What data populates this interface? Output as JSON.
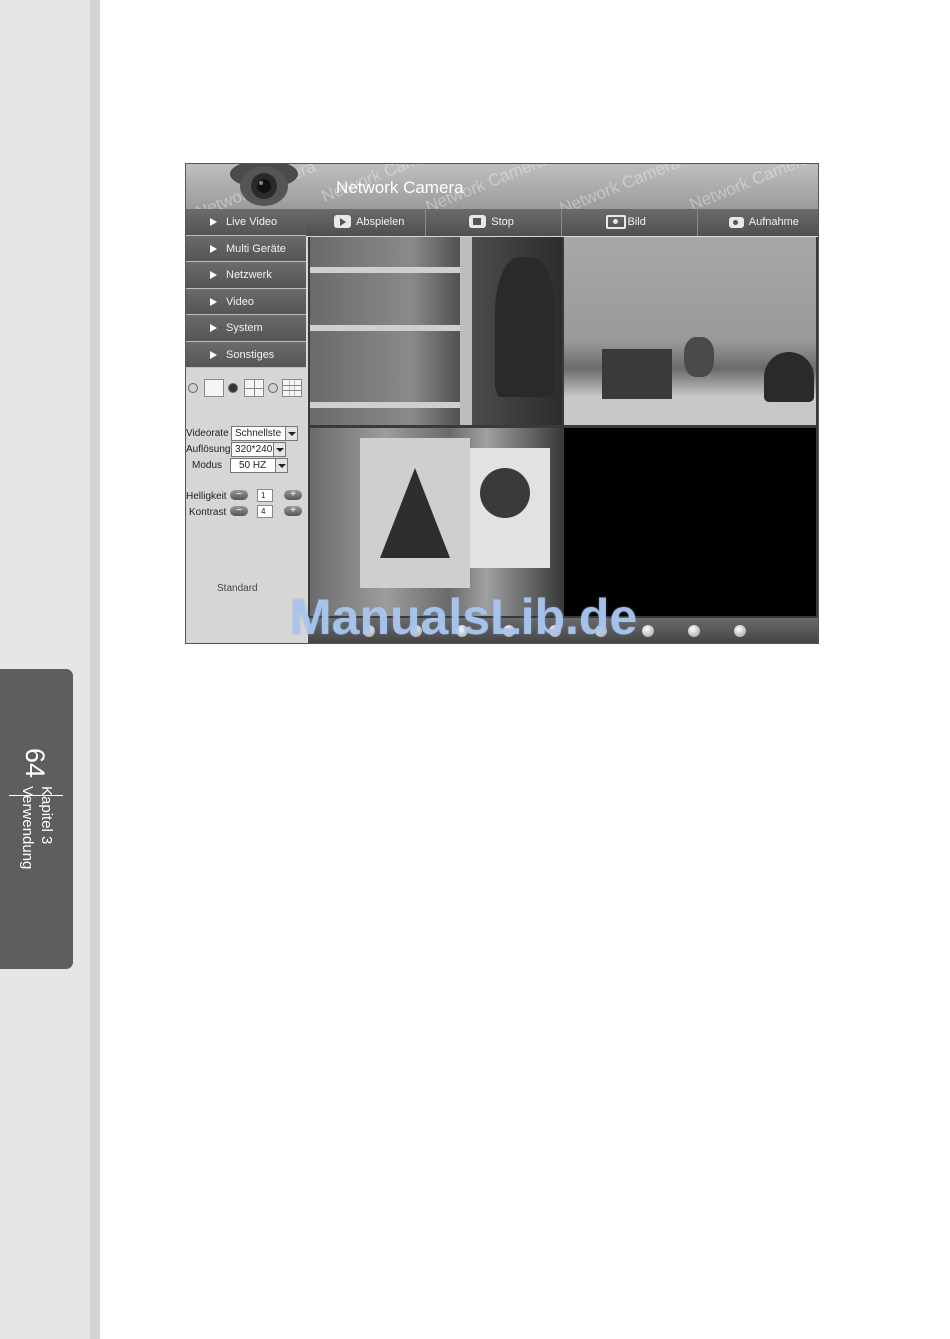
{
  "page": {
    "page_number": "64",
    "chapter_line1": "Kapitel 3",
    "chapter_line2": "Verwendung",
    "watermark": "ManualsLib.de"
  },
  "app": {
    "title": "Network Camera",
    "header_watermarks": [
      "Network Camera",
      "Network Camera",
      "Network Camera",
      "Network Camera",
      "Network Camera"
    ]
  },
  "sidebar": {
    "items": [
      {
        "label": "Live Video"
      },
      {
        "label": "Multi Geräte"
      },
      {
        "label": "Netzwerk"
      },
      {
        "label": "Video"
      },
      {
        "label": "System"
      },
      {
        "label": "Sonstiges"
      }
    ],
    "layouts": {
      "options": [
        "1 view",
        "4 views",
        "9 views"
      ],
      "selected": "4 views"
    }
  },
  "controls": {
    "videorate": {
      "label": "Videorate",
      "value": "Schnellste"
    },
    "aufloesung": {
      "label": "Auflösung",
      "value": "320*240"
    },
    "modus": {
      "label": "Modus",
      "value": "50 HZ"
    },
    "helligkeit": {
      "label": "Helligkeit",
      "value": "1",
      "minus": "−",
      "plus": "+"
    },
    "kontrast": {
      "label": "Kontrast",
      "value": "4",
      "minus": "−",
      "plus": "+"
    },
    "standard": "Standard"
  },
  "toolbar": {
    "abspielen": "Abspielen",
    "stop": "Stop",
    "bild": "Bild",
    "aufnahme": "Aufnahme"
  },
  "icons": {
    "play": "play-icon",
    "stop": "stop-icon",
    "snapshot": "camera-icon",
    "record": "record-icon"
  },
  "colors": {
    "nav_bg": "#5e5e5e",
    "header_bg": "#a8a8a8",
    "app_bg": "#d8d8d8",
    "watermark": "#aac8f0",
    "chapter_tab": "#5e5e5e"
  }
}
